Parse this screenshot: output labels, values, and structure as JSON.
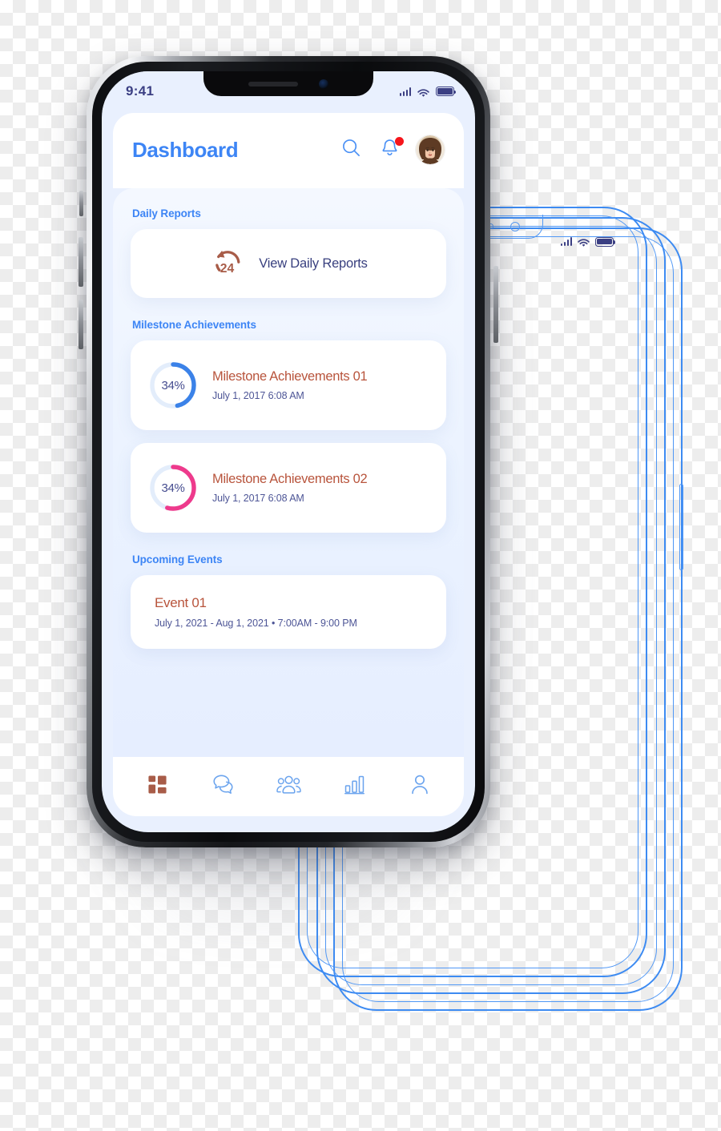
{
  "colors": {
    "accent_blue": "#3d85f5",
    "screen_bg": "#e9f0fe",
    "card_white": "#ffffff",
    "title_rust": "#b8543c",
    "icon_rust": "#a85c48",
    "ring_blue": "#3b82e8",
    "ring_pink": "#ee3a8c",
    "ring_track": "#e3edfb",
    "text_navy": "#39407f",
    "status_navy": "#3b3f83",
    "badge_red": "#f6151b",
    "wireframe_blue": "#3d8bf2"
  },
  "status_bar": {
    "time": "9:41",
    "icons": [
      "signal-icon",
      "wifi-icon",
      "battery-icon"
    ]
  },
  "header": {
    "title": "Dashboard",
    "search_icon": "search-icon",
    "notifications_icon": "bell-icon",
    "has_notification_badge": true,
    "avatar_name": "user-avatar"
  },
  "sections": [
    {
      "key": "daily_reports",
      "title": "Daily Reports",
      "card": {
        "icon": "24-hours-icon",
        "label": "View Daily Reports"
      }
    },
    {
      "key": "milestones",
      "title": "Milestone Achievements",
      "items": [
        {
          "percent": "34%",
          "percent_value": 34,
          "ring_color": "#3b82e8",
          "sweep_deg": 168,
          "name": "Milestone Achievements 01",
          "date": "July 1, 2017 6:08 AM"
        },
        {
          "percent": "34%",
          "percent_value": 34,
          "ring_color": "#ee3a8c",
          "sweep_deg": 196,
          "name": "Milestone Achievements 02",
          "date": "July 1, 2017 6:08 AM"
        }
      ]
    },
    {
      "key": "upcoming_events",
      "title": "Upcoming Events",
      "items": [
        {
          "name": "Event 01",
          "meta": "July 1, 2021 - Aug 1, 2021 • 7:00AM - 9:00 PM"
        }
      ]
    }
  ],
  "bottom_nav": {
    "items": [
      {
        "icon": "dashboard-grid-icon",
        "active": true
      },
      {
        "icon": "chat-bubbles-icon",
        "active": false
      },
      {
        "icon": "people-group-icon",
        "active": false
      },
      {
        "icon": "bar-chart-icon",
        "active": false
      },
      {
        "icon": "user-profile-icon",
        "active": false
      }
    ]
  },
  "wireframe_phones": {
    "count": 3,
    "status_icons": [
      "signal-icon",
      "wifi-icon",
      "battery-icon"
    ]
  }
}
